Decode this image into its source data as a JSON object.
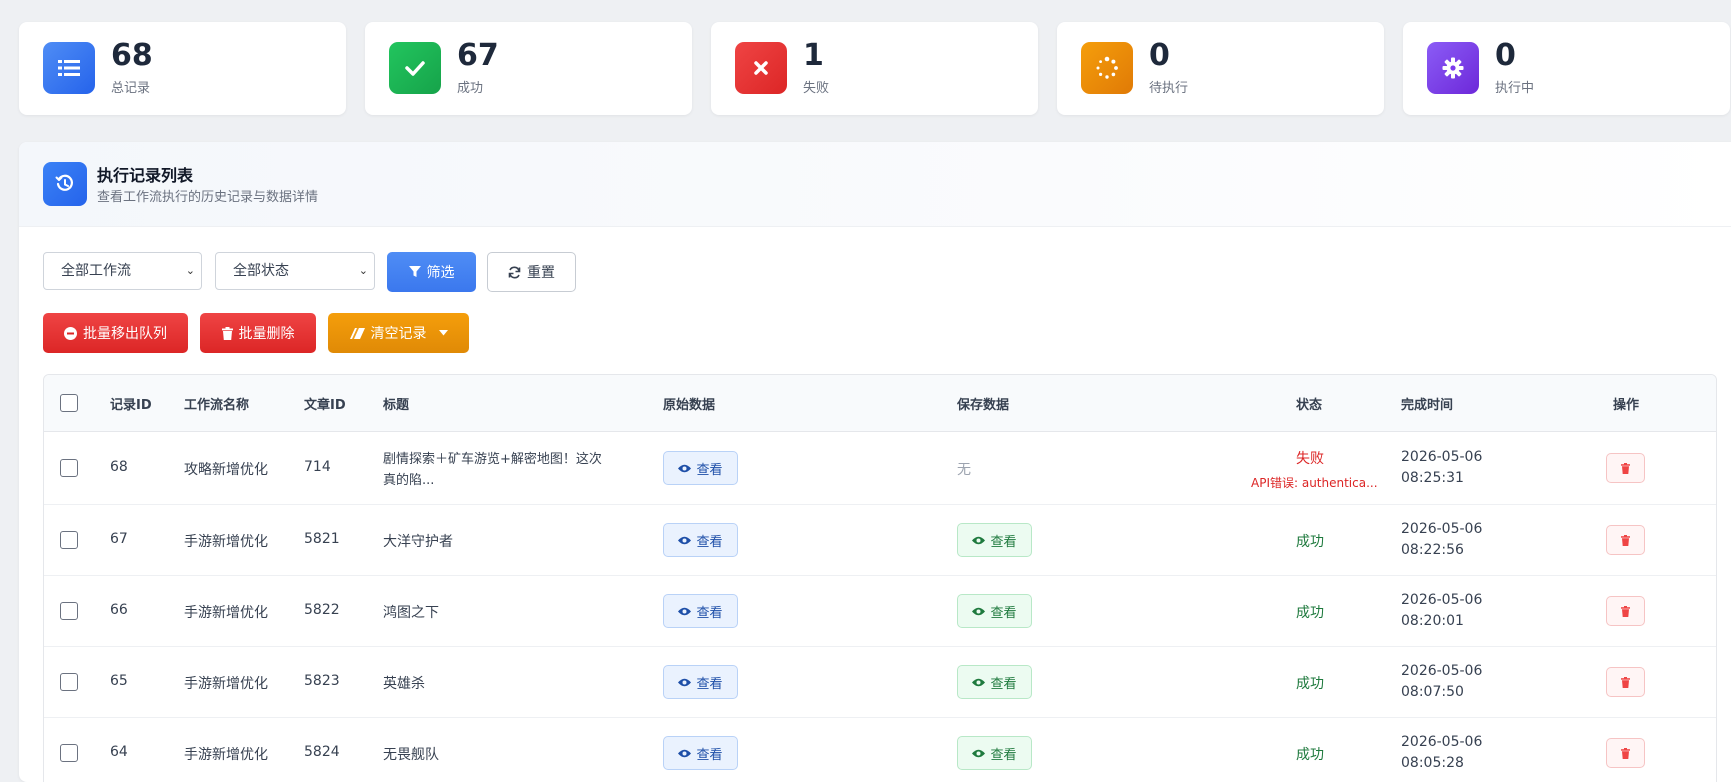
{
  "stats": [
    {
      "value": "68",
      "label": "总记录",
      "icon": "list-icon",
      "color": "#3b82f6"
    },
    {
      "value": "67",
      "label": "成功",
      "icon": "check-icon",
      "color": "#16a34a"
    },
    {
      "value": "1",
      "label": "失败",
      "icon": "x-icon",
      "color": "#dc2626"
    },
    {
      "value": "0",
      "label": "待执行",
      "icon": "spinner-icon",
      "color": "#ea8a06"
    },
    {
      "value": "0",
      "label": "执行中",
      "icon": "gear-icon",
      "color": "#7c3aed"
    }
  ],
  "panel": {
    "title": "执行记录列表",
    "subtitle": "查看工作流执行的历史记录与数据详情"
  },
  "filters": {
    "workflow_select": "全部工作流",
    "status_select": "全部状态",
    "filter_button": "筛选",
    "reset_button": "重置"
  },
  "actions": {
    "bulk_dequeue": "批量移出队列",
    "bulk_delete": "批量删除",
    "clear_records": "清空记录"
  },
  "table": {
    "headers": {
      "record_id": "记录ID",
      "workflow": "工作流名称",
      "article_id": "文章ID",
      "title": "标题",
      "raw_data": "原始数据",
      "saved_data": "保存数据",
      "status": "状态",
      "finish_time": "完成时间",
      "ops": "操作"
    },
    "view_label": "查看",
    "none_label": "无",
    "rows": [
      {
        "id": "68",
        "workflow": "攻略新增优化",
        "article_id": "714",
        "title_l1": "剧情探索＋矿车游览+解密地图！这次",
        "title_l2": "真的陷...",
        "status": "失败",
        "error": "API错误: authentica...",
        "date": "2026-05-06",
        "time": "08:25:31"
      },
      {
        "id": "67",
        "workflow": "手游新增优化",
        "article_id": "5821",
        "title_l1": "大洋守护者",
        "title_l2": "",
        "status": "成功",
        "error": "",
        "date": "2026-05-06",
        "time": "08:22:56"
      },
      {
        "id": "66",
        "workflow": "手游新增优化",
        "article_id": "5822",
        "title_l1": "鸿图之下",
        "title_l2": "",
        "status": "成功",
        "error": "",
        "date": "2026-05-06",
        "time": "08:20:01"
      },
      {
        "id": "65",
        "workflow": "手游新增优化",
        "article_id": "5823",
        "title_l1": "英雄杀",
        "title_l2": "",
        "status": "成功",
        "error": "",
        "date": "2026-05-06",
        "time": "08:07:50"
      },
      {
        "id": "64",
        "workflow": "手游新增优化",
        "article_id": "5824",
        "title_l1": "无畏舰队",
        "title_l2": "",
        "status": "成功",
        "error": "",
        "date": "2026-05-06",
        "time": "08:05:28"
      }
    ]
  }
}
